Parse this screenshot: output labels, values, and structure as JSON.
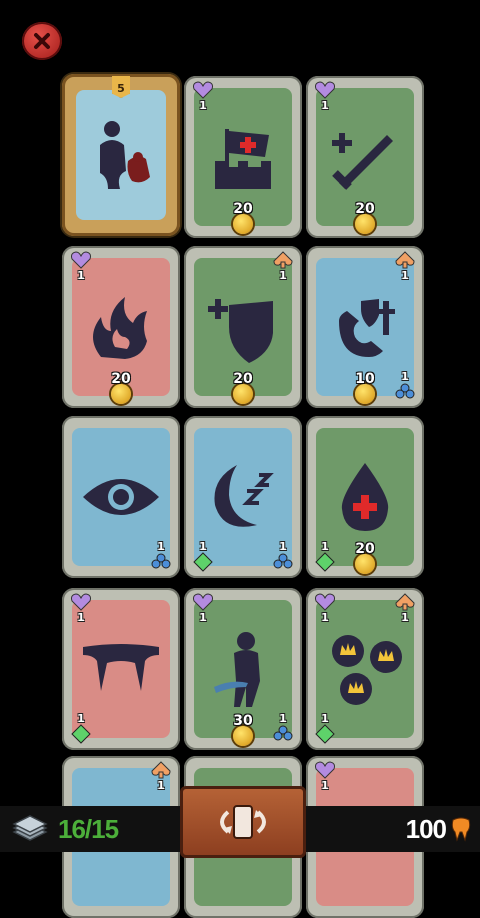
{
  "hud": {
    "deck_count": "16/15",
    "teeth_count": "100"
  },
  "colors": {
    "close": "#c0312d",
    "green": "#6f9a69",
    "blue": "#7fb7d0",
    "red": "#d98c86",
    "deck_count": "#4caf3a",
    "shuffle": "#a24b27"
  },
  "cards": [
    {
      "id": "hero",
      "icon": "hero-silhouette-icon",
      "bg": "gold",
      "banner": "5"
    },
    {
      "id": "castle",
      "icon": "castle-flag-icon",
      "bg": "green",
      "tl": "1",
      "cost": "20"
    },
    {
      "id": "sword",
      "icon": "sword-plus-icon",
      "bg": "green",
      "tl": "1",
      "cost": "20"
    },
    {
      "id": "fire",
      "icon": "fire-icon",
      "bg": "red",
      "tl": "1",
      "cost": "20"
    },
    {
      "id": "shield",
      "icon": "shield-plus-icon",
      "bg": "green",
      "tr": "1",
      "cost": "20"
    },
    {
      "id": "magnet",
      "icon": "magnet-shield-icon",
      "bg": "blue",
      "tr": "1",
      "cost": "10",
      "br": "1"
    },
    {
      "id": "eye",
      "icon": "eye-icon",
      "bg": "blue",
      "br": "1"
    },
    {
      "id": "sleep",
      "icon": "moon-sleep-icon",
      "bg": "blue",
      "bl": "1",
      "br": "1"
    },
    {
      "id": "blood",
      "icon": "blood-drop-icon",
      "bg": "green",
      "bl": "1",
      "cost": "20"
    },
    {
      "id": "fangs",
      "icon": "fangs-icon",
      "bg": "red",
      "tl": "1",
      "bl": "1"
    },
    {
      "id": "ninja",
      "icon": "ninja-icon",
      "bg": "green",
      "tl": "1",
      "cost": "30",
      "br": "1"
    },
    {
      "id": "crowns",
      "icon": "crown-coins-icon",
      "bg": "green",
      "tl": "1",
      "tr": "1",
      "bl": "1"
    },
    {
      "id": "partial1",
      "bg": "blue",
      "tr": "1"
    },
    {
      "id": "partial2",
      "bg": "green"
    },
    {
      "id": "partial3",
      "bg": "red",
      "tl": "1"
    }
  ]
}
